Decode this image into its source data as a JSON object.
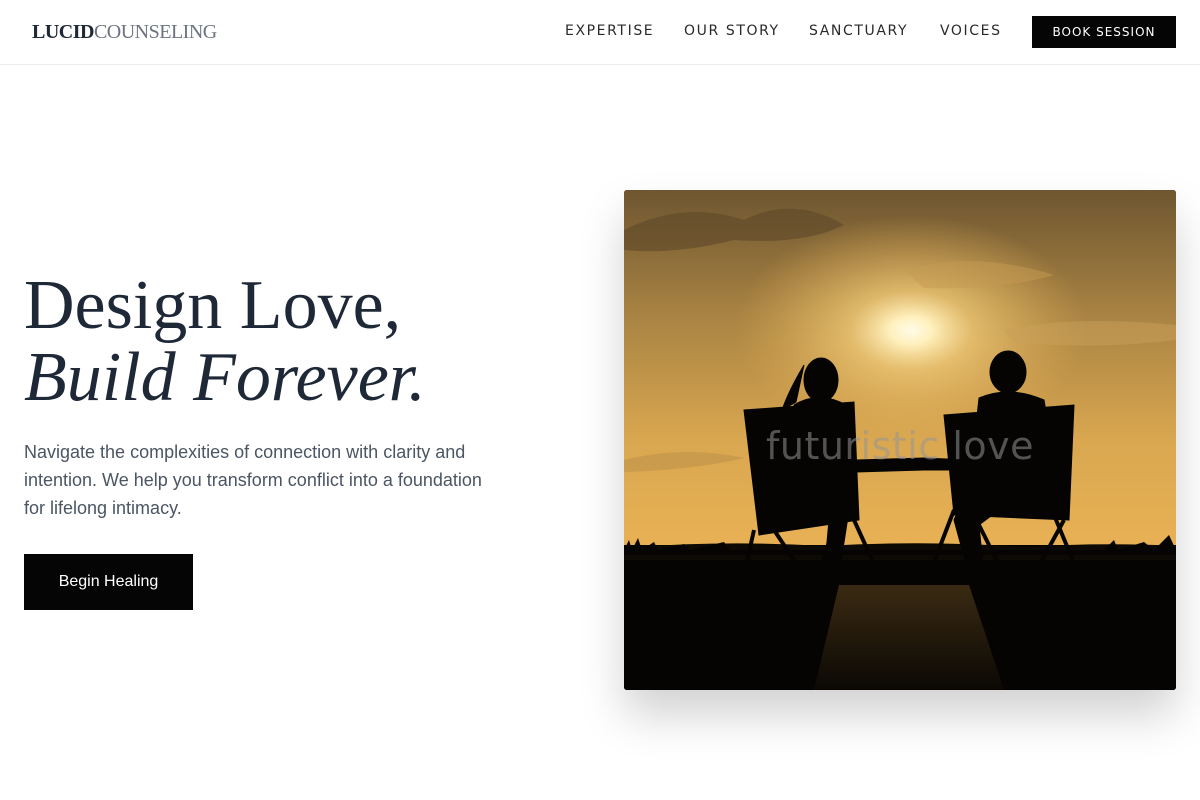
{
  "header": {
    "logo_bold": "LUCID",
    "logo_light": "COUNSELING",
    "nav": [
      "EXPERTISE",
      "OUR STORY",
      "SANCTUARY",
      "VOICES"
    ],
    "cta_label": "BOOK SESSION"
  },
  "hero": {
    "title_line1": "Design Love,",
    "title_line2": "Build Forever.",
    "subtitle": "Navigate the complexities of connection with clarity and intention. We help you transform conflict into a foundation for lifelong intimacy.",
    "button_label": "Begin Healing",
    "image": {
      "subject": "couple-silhouette-sunset",
      "watermark": "futuristic love"
    }
  },
  "colors": {
    "heading": "#1e2837",
    "button_bg": "#050505",
    "body_text": "#4b5563"
  }
}
